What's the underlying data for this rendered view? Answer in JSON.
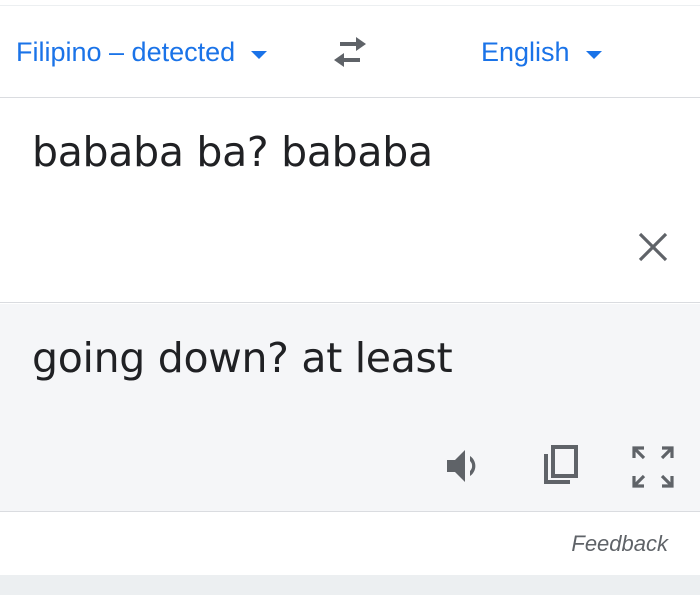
{
  "languages": {
    "source_label": "Filipino – detected",
    "target_label": "English"
  },
  "source": {
    "text": "bababa ba? bababa"
  },
  "result": {
    "text": "going down? at least"
  },
  "footer": {
    "feedback_label": "Feedback"
  },
  "colors": {
    "accent": "#1a73e8",
    "icon": "#5f6368",
    "text": "#202124",
    "result_bg": "#f5f6f8",
    "divider": "#dadce0"
  },
  "icons": [
    "chevron-down-icon",
    "swap-icon",
    "close-icon",
    "speaker-icon",
    "copy-icon",
    "fullscreen-icon"
  ]
}
